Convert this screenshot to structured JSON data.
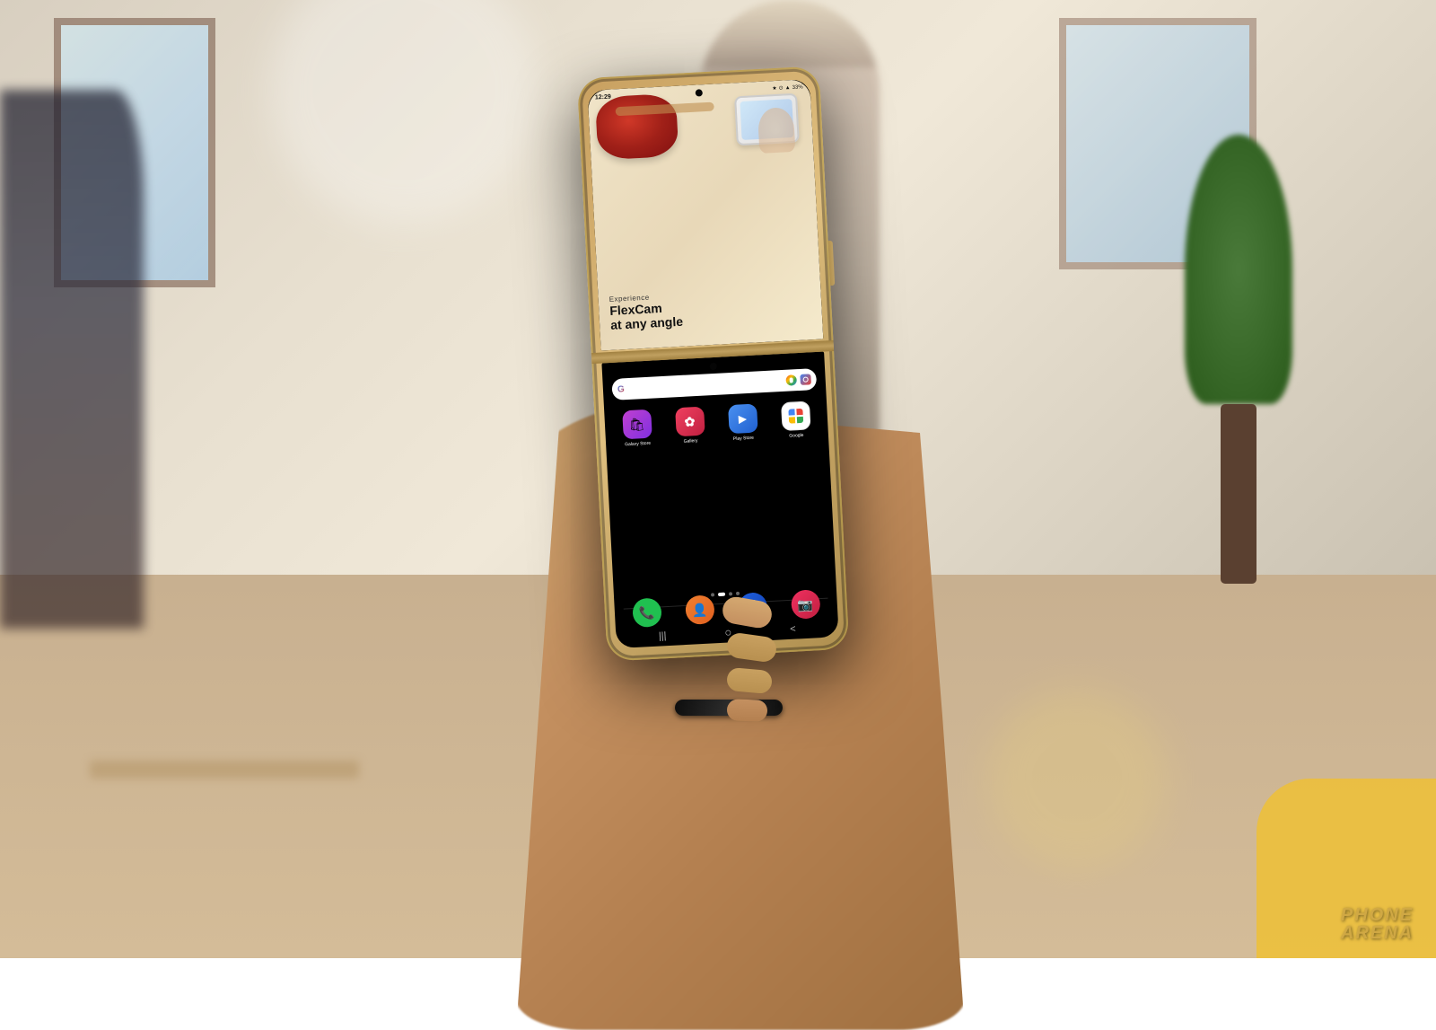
{
  "background": {
    "colors": {
      "wall": "#d8cfc0",
      "floor": "#c8b090",
      "window_light": "#d0e8f0",
      "yellow_accent": "#f0c030"
    }
  },
  "phone": {
    "body_color": "#d4b878",
    "screen_bg": "#000000",
    "fold_type": "flip"
  },
  "status_bar": {
    "time": "12:29",
    "icons": "★ ⊙ ▲",
    "network": "33%"
  },
  "upper_screen": {
    "promo": {
      "label": "Experience",
      "title_line1": "FlexCam",
      "title_line2": "at any angle"
    }
  },
  "search_bar": {
    "g_label": "G",
    "placeholder": ""
  },
  "app_grid": {
    "apps": [
      {
        "id": "galaxy-store",
        "label": "Galaxy Store",
        "bg": "#c040c0",
        "icon": "🛍"
      },
      {
        "id": "gallery",
        "label": "Gallery",
        "bg": "#f04060",
        "icon": "✿"
      },
      {
        "id": "play-store",
        "label": "Play Store",
        "bg": "#4080f0",
        "icon": "▶"
      },
      {
        "id": "google",
        "label": "Google",
        "bg": "#ffffff",
        "icon": "G"
      }
    ]
  },
  "dock_apps": [
    {
      "id": "phone",
      "label": "",
      "bg": "#20c050",
      "icon": "📞"
    },
    {
      "id": "contacts",
      "label": "",
      "bg": "#f08030",
      "icon": "👤"
    },
    {
      "id": "samsung-internet",
      "label": "",
      "bg": "#2070f0",
      "icon": "⬟"
    },
    {
      "id": "camera",
      "label": "",
      "bg": "#f03060",
      "icon": "📷"
    }
  ],
  "page_dots": {
    "count": 4,
    "active": 1
  },
  "nav_bar": {
    "items": [
      "|||",
      "○",
      "<"
    ]
  },
  "watermark": {
    "line1": "PHONE",
    "line2": "ARENA"
  }
}
